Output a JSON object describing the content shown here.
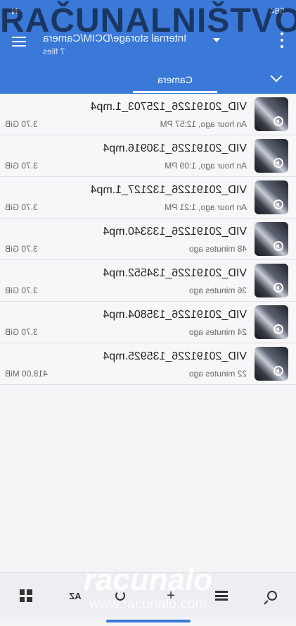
{
  "status": {
    "left": "584",
    "right": "N"
  },
  "header": {
    "path": "Internal storage/DCIM/Camera",
    "file_count": "7 files"
  },
  "tabs": [
    {
      "label": "Camera",
      "active": true
    }
  ],
  "files": [
    {
      "name": "VID_20191226_125703_1.mp4",
      "modified": "An hour ago, 12:57 PM",
      "size": "3.70 GiB"
    },
    {
      "name": "VID_20191226_130916.mp4",
      "modified": "An hour ago, 1:09 PM",
      "size": "3.70 GiB"
    },
    {
      "name": "VID_20191226_132127_1.mp4",
      "modified": "An hour ago, 1:21 PM",
      "size": "3.70 GiB"
    },
    {
      "name": "VID_20191226_133340.mp4",
      "modified": "48 minutes ago",
      "size": "3.70 GiB"
    },
    {
      "name": "VID_20191226_134552.mp4",
      "modified": "36 minutes ago",
      "size": "3.70 GiB"
    },
    {
      "name": "VID_20191226_135804.mp4",
      "modified": "24 minutes ago",
      "size": "3.70 GiB"
    },
    {
      "name": "VID_20191226_135925.mp4",
      "modified": "22 minutes ago",
      "size": "418.00 MiB"
    }
  ],
  "bottom_bar": {
    "items": [
      {
        "icon": "search-icon"
      },
      {
        "icon": "list-view-icon"
      },
      {
        "icon": "add-icon",
        "glyph": "+"
      },
      {
        "icon": "refresh-icon"
      },
      {
        "icon": "sort-az-icon",
        "label": "AZ"
      },
      {
        "icon": "select-all-icon"
      }
    ]
  },
  "watermark": {
    "title": "RAČUNALNIŠTVO",
    "logo": "racunalo",
    "url": "www.racunalo.com"
  },
  "colors": {
    "accent": "#3a79d8",
    "background": "#f4f4f6"
  }
}
